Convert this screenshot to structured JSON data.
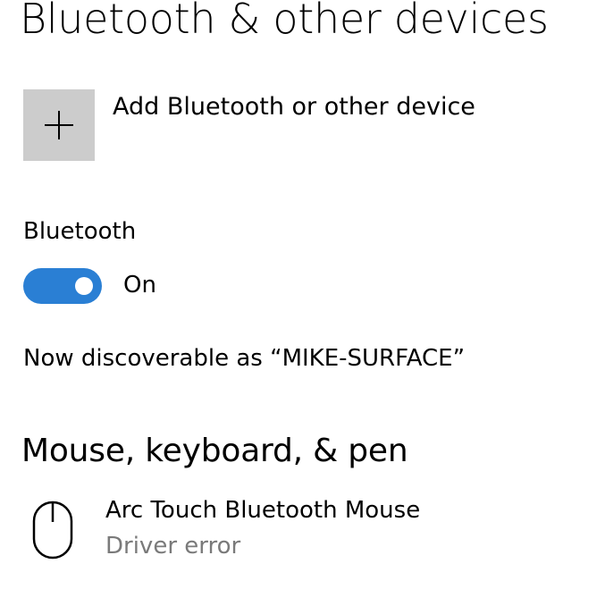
{
  "page": {
    "title": "Bluetooth & other devices"
  },
  "add_device": {
    "icon": "plus-icon",
    "label": "Add Bluetooth or other device"
  },
  "bluetooth": {
    "label": "Bluetooth",
    "toggle_state": "On",
    "toggle_on": true,
    "toggle_color": "#2a7fd4",
    "discoverable_text": "Now discoverable as “MIKE-SURFACE”"
  },
  "mouse_keyboard_pen": {
    "heading": "Mouse, keyboard, & pen",
    "devices": [
      {
        "icon": "mouse-icon",
        "name": "Arc Touch Bluetooth Mouse",
        "status": "Driver error"
      }
    ]
  }
}
